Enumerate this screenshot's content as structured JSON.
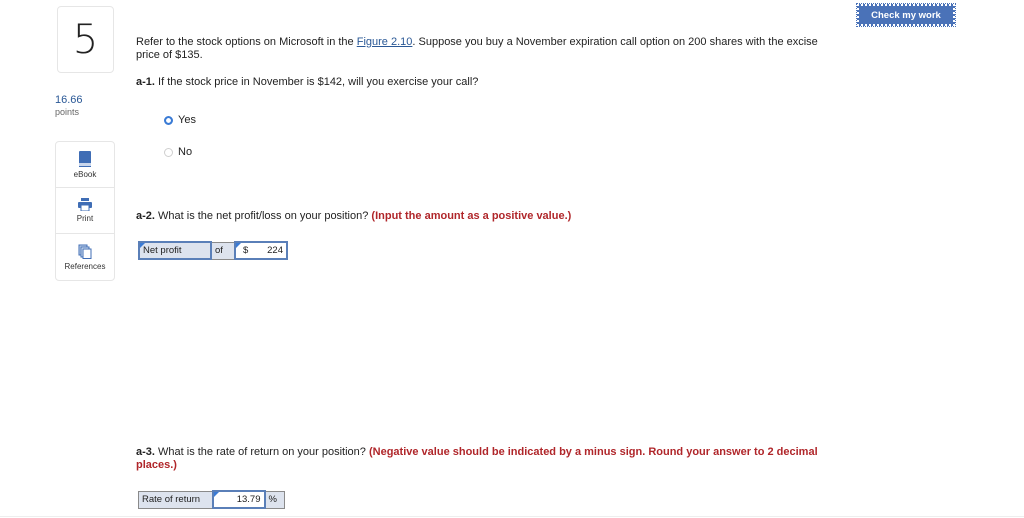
{
  "question": {
    "number": "5",
    "points_value": "16.66",
    "points_label": "points"
  },
  "tools": [
    {
      "label": "eBook",
      "icon": "book-icon"
    },
    {
      "label": "Print",
      "icon": "printer-icon"
    },
    {
      "label": "References",
      "icon": "references-icon"
    }
  ],
  "header": {
    "check_button_label": "Check my work"
  },
  "prompt": {
    "text_before_link": "Refer to the stock options on Microsoft in the ",
    "link_text": "Figure 2.10",
    "text_after_link": ". Suppose you buy a November expiration call option on 200 shares with the excise price of $135."
  },
  "part_a1": {
    "label": "a-1.",
    "question": " If the stock price in November is $142, will you exercise your call?",
    "options": [
      {
        "label": "Yes",
        "selected": true
      },
      {
        "label": "No",
        "selected": false
      }
    ]
  },
  "part_a2": {
    "label": "a-2.",
    "question": " What is the net profit/loss on your position? ",
    "hint": "(Input the amount as a positive value.)",
    "select_value": "Net profit",
    "of_label": "of",
    "currency": "$",
    "amount": "224"
  },
  "part_a3": {
    "label": "a-3.",
    "question": " What is the rate of return on your position? ",
    "hint": "(Negative value should be indicated by a minus sign. Round your answer to 2 decimal places.)",
    "row_label": "Rate of return",
    "value": "13.79",
    "unit": "%"
  }
}
